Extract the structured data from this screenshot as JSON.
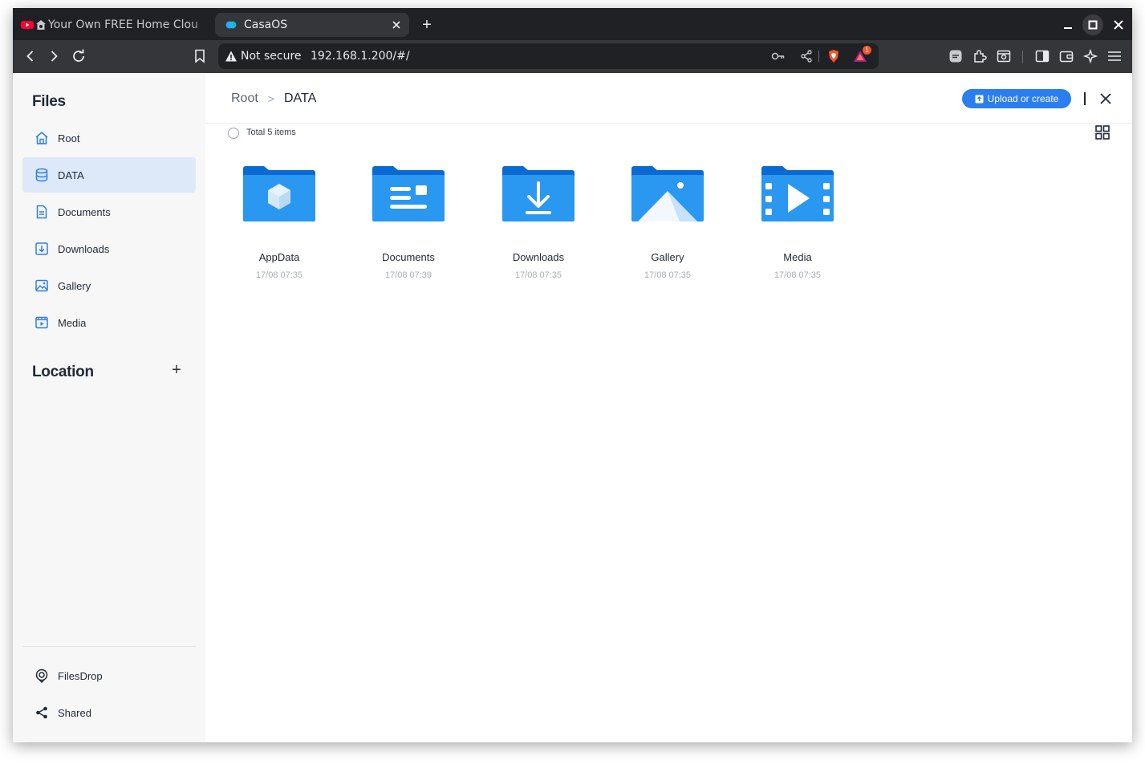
{
  "browser": {
    "tabs": [
      {
        "title": "Your Own FREE Home Clou",
        "active": false
      },
      {
        "title": "CasaOS",
        "active": true
      }
    ],
    "address": {
      "security": "Not secure",
      "url": "192.168.1.200/#/"
    },
    "brave_badge": "1"
  },
  "sidebar": {
    "files_heading": "Files",
    "items": [
      {
        "label": "Root",
        "icon": "home-icon"
      },
      {
        "label": "DATA",
        "icon": "database-icon",
        "active": true
      },
      {
        "label": "Documents",
        "icon": "document-icon"
      },
      {
        "label": "Downloads",
        "icon": "download-icon"
      },
      {
        "label": "Gallery",
        "icon": "image-icon"
      },
      {
        "label": "Media",
        "icon": "video-icon"
      }
    ],
    "location_heading": "Location",
    "bottom_items": [
      {
        "label": "FilesDrop",
        "icon": "filesdrop-icon"
      },
      {
        "label": "Shared",
        "icon": "share-icon"
      }
    ]
  },
  "main": {
    "breadcrumb": {
      "root": "Root",
      "separator": ">",
      "current": "DATA"
    },
    "upload_button": "Upload or create",
    "count": "Total 5 items",
    "folders": [
      {
        "name": "AppData",
        "date": "17/08 07:35",
        "icon": "appdata-folder-icon"
      },
      {
        "name": "Documents",
        "date": "17/08 07:39",
        "icon": "documents-folder-icon"
      },
      {
        "name": "Downloads",
        "date": "17/08 07:35",
        "icon": "downloads-folder-icon"
      },
      {
        "name": "Gallery",
        "date": "17/08 07:35",
        "icon": "gallery-folder-icon"
      },
      {
        "name": "Media",
        "date": "17/08 07:35",
        "icon": "media-folder-icon"
      }
    ]
  },
  "colors": {
    "accent": "#2b7ef0",
    "sidebar_active": "#dde8f9",
    "folder_dark": "#0b6ad1",
    "folder_light": "#2a97f0"
  }
}
